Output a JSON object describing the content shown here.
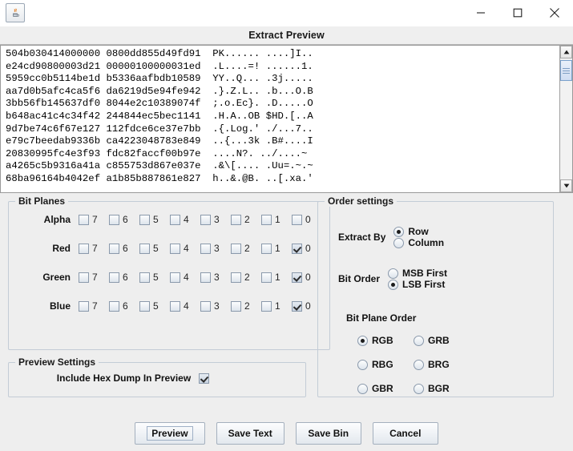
{
  "window": {
    "app_icon": "java-coffee-cup-icon",
    "minimize_label": "minimize-icon",
    "maximize_label": "maximize-icon",
    "close_label": "close-icon"
  },
  "dialog": {
    "title": "Extract Preview"
  },
  "preview": {
    "scrollbar": {
      "up_arrow": "scroll-up-icon",
      "down_arrow": "scroll-down-icon"
    },
    "hex_lines": [
      {
        "col1": "504b030414000000",
        "col2": "0800dd855d49fd91",
        "col3": "PK......",
        "col4": "....]I.."
      },
      {
        "col1": "e24cd90800003d21",
        "col2": "00000100000031ed",
        "col3": ".L....=!",
        "col4": "......1."
      },
      {
        "col1": "5959cc0b5114be1d",
        "col2": "b5336aafbdb10589",
        "col3": "YY..Q...",
        "col4": ".3j....."
      },
      {
        "col1": "aa7d0b5afc4ca5f6",
        "col2": "da6219d5e94fe942",
        "col3": ".}.Z.L..",
        "col4": ".b...O.B"
      },
      {
        "col1": "3bb56fb145637df0",
        "col2": "8044e2c10389074f",
        "col3": ";.o.Ec}.",
        "col4": ".D.....O"
      },
      {
        "col1": "b648ac41c4c34f42",
        "col2": "244844ec5bec1141",
        "col3": ".H.A..OB",
        "col4": "$HD.[..A"
      },
      {
        "col1": "9d7be74c6f67e127",
        "col2": "112fdce6ce37e7bb",
        "col3": ".{.Log.'",
        "col4": "./...7.."
      },
      {
        "col1": "e79c7beedab9336b",
        "col2": "ca4223048783e849",
        "col3": "..{...3k",
        "col4": ".B#....I"
      },
      {
        "col1": "20830995fc4e3f93",
        "col2": "fdc82faccf00b97e",
        "col3": "....N?.",
        "col4": "../....~"
      },
      {
        "col1": "a4265c5b9316a41a",
        "col2": "c855753d867e037e",
        "col3": ".&\\[....",
        "col4": ".Uu=.~.~"
      },
      {
        "col1": "68ba96164b4042ef",
        "col2": "a1b85b887861e827",
        "col3": "h..&.@B.",
        "col4": "..[.xa.'"
      }
    ]
  },
  "bit_planes": {
    "legend": "Bit Planes",
    "bit_labels": [
      "7",
      "6",
      "5",
      "4",
      "3",
      "2",
      "1",
      "0"
    ],
    "rows": [
      {
        "channel": "Alpha",
        "checked": [
          false,
          false,
          false,
          false,
          false,
          false,
          false,
          false
        ]
      },
      {
        "channel": "Red",
        "checked": [
          false,
          false,
          false,
          false,
          false,
          false,
          false,
          true
        ]
      },
      {
        "channel": "Green",
        "checked": [
          false,
          false,
          false,
          false,
          false,
          false,
          false,
          true
        ]
      },
      {
        "channel": "Blue",
        "checked": [
          false,
          false,
          false,
          false,
          false,
          false,
          false,
          true
        ]
      }
    ]
  },
  "preview_settings": {
    "legend": "Preview Settings",
    "include_hex_dump_label": "Include Hex Dump In Preview",
    "include_hex_dump_checked": true
  },
  "order_settings": {
    "legend": "Order settings",
    "extract_by_label": "Extract By",
    "extract_by_options": [
      {
        "label": "Row",
        "selected": true
      },
      {
        "label": "Column",
        "selected": false
      }
    ],
    "bit_order_label": "Bit Order",
    "bit_order_options": [
      {
        "label": "MSB First",
        "selected": false
      },
      {
        "label": "LSB First",
        "selected": true
      }
    ],
    "bit_plane_order_label": "Bit Plane Order",
    "bit_plane_order_options": [
      {
        "label": "RGB",
        "selected": true
      },
      {
        "label": "GRB",
        "selected": false
      },
      {
        "label": "RBG",
        "selected": false
      },
      {
        "label": "BRG",
        "selected": false
      },
      {
        "label": "GBR",
        "selected": false
      },
      {
        "label": "BGR",
        "selected": false
      }
    ]
  },
  "buttons": [
    {
      "label": "Preview",
      "focused": true
    },
    {
      "label": "Save Text",
      "focused": false
    },
    {
      "label": "Save Bin",
      "focused": false
    },
    {
      "label": "Cancel",
      "focused": false
    }
  ],
  "colors": {
    "background": "#eeeeee",
    "title_strip": "#efefef",
    "panel_border": "#c3ccd6",
    "scroll_thumb": "#cfddf2",
    "text": "#111111"
  }
}
